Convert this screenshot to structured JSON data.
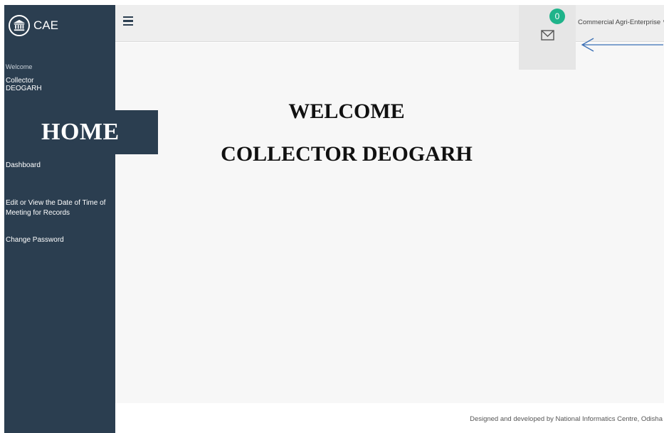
{
  "app": {
    "brand_name": "CAE",
    "brand_icon": "government-building-icon"
  },
  "sidebar": {
    "welcome_label": "Welcome",
    "user_name": "Collector\nDEOGARH",
    "home_label": "HOME",
    "items": [
      {
        "label": "Dashboard"
      },
      {
        "label": "Edit or View the Date of Time of Meeting for Records"
      },
      {
        "label": "Change Password"
      }
    ]
  },
  "header": {
    "menu_icon": "hamburger-icon",
    "mail_icon": "envelope-icon",
    "notification_count": "0",
    "org_dropdown": "Commercial Agri-Enterprise ∨"
  },
  "main": {
    "welcome_line1": "WELCOME",
    "welcome_line2": "COLLECTOR DEOGARH"
  },
  "footer": {
    "text": "Designed and developed by National Informatics Centre, Odisha"
  },
  "colors": {
    "sidebar_bg": "#2b3e50",
    "badge": "#1fb38a",
    "annotation_arrow": "#3a6fb5"
  }
}
